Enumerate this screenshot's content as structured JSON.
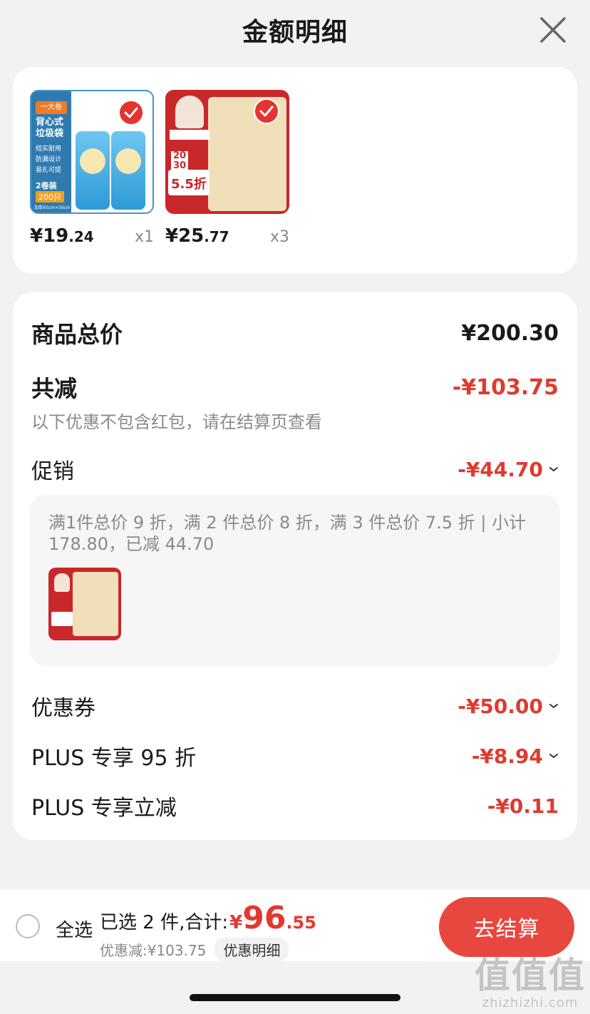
{
  "header": {
    "title": "金额明细"
  },
  "products": [
    {
      "price_int": "¥19",
      "price_dec": ".24",
      "qty": "x1",
      "img_text": {
        "tag": "一大卷",
        "title_1": "背心式",
        "title_2": "垃圾袋",
        "feature_1": "结实耐用",
        "feature_2": "防漏设计",
        "feature_3": "易扎可提",
        "pack": "2卷装",
        "count": "200只",
        "size": "加厚45cm×50cm"
      }
    },
    {
      "price_int": "¥25",
      "price_dec": ".77",
      "qty": "x3",
      "img_text": {
        "n1": "20",
        "n2": "30",
        "discount": "5.5折"
      }
    }
  ],
  "detail": {
    "total_label": "商品总价",
    "total_value": "¥200.30",
    "reduce_label": "共减",
    "reduce_value": "-¥103.75",
    "note": "以下优惠不包含红包，请在结算页查看",
    "promo_label": "促销",
    "promo_value": "-¥44.70",
    "promo_desc": "满1件总价 9 折，满 2 件总价 8 折，满 3 件总价 7.5 折 | 小计 178.80，已减 44.70",
    "coupon_label": "优惠券",
    "coupon_value": "-¥50.00",
    "plus95_label": "PLUS 专享 95 折",
    "plus95_value": "-¥8.94",
    "plus_cut_label": "PLUS 专享立减",
    "plus_cut_value": "-¥0.11"
  },
  "bottom": {
    "select_all": "全选",
    "selected_text": "已选 2 件,合计:",
    "total_yen": "¥",
    "total_int": "96",
    "total_dec": ".55",
    "discount_text": "优惠减:¥103.75",
    "detail_tag": "优惠明细",
    "checkout": "去结算"
  },
  "watermark": {
    "chars": "值值值",
    "url": "zhizhizhi.com"
  },
  "colors": {
    "accent_red": "#e03a2f",
    "button_red": "#e8473f",
    "background": "#f2f2f2"
  }
}
